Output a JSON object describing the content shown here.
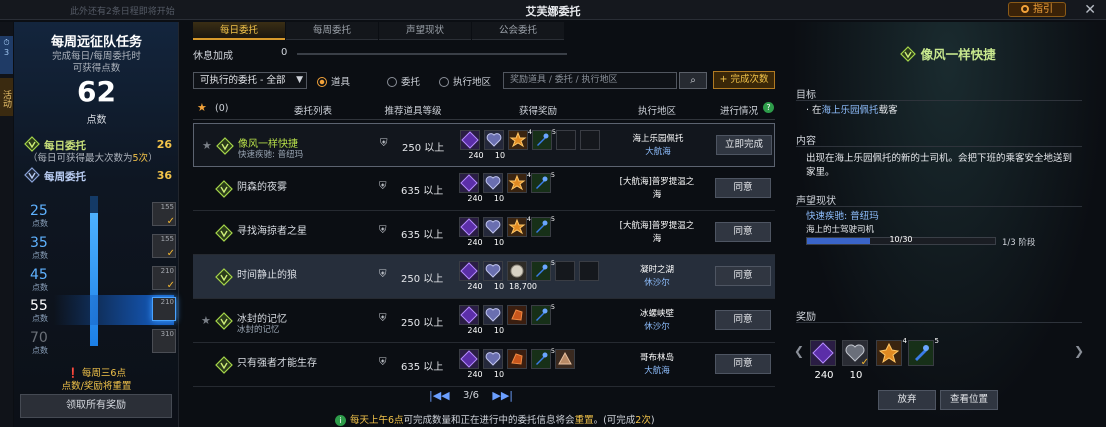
{
  "window": {
    "title": "艾芙娜委托",
    "notice": "此外还有2条日程即将开始",
    "guide": "指引"
  },
  "edge": {
    "count": "3",
    "label": "活动"
  },
  "left": {
    "title": "每周远征队任务",
    "subtitle": "完成每日/每周委托时",
    "subtitle2": "可获得点数",
    "points": "62",
    "points_unit": "点数",
    "daily_label": "每日委托",
    "daily_value": "26",
    "note_pre": "（每日可获得最大次数为",
    "note_num": "5次",
    "note_post": "）",
    "weekly_label": "每周委托",
    "weekly_value": "36",
    "progress_fraction": 0.886,
    "tiers": [
      {
        "num": "25",
        "unit": "点数",
        "count": "155"
      },
      {
        "num": "35",
        "unit": "点数",
        "count": "155"
      },
      {
        "num": "45",
        "unit": "点数",
        "count": "210"
      },
      {
        "num": "55",
        "unit": "点数",
        "count": "210"
      },
      {
        "num": "70",
        "unit": "点数",
        "count": "310"
      }
    ],
    "reset_line1": "每周三6点",
    "reset_line2": "点数/奖励将重置",
    "claim_all": "领取所有奖励"
  },
  "tabs": [
    "每日委托",
    "每周委托",
    "声望现状",
    "公会委托"
  ],
  "rest": {
    "label": "休息加成",
    "value": "0"
  },
  "filter": {
    "select": "可执行的委托 - 全部",
    "radio_items": "道具",
    "radio_quest": "委托",
    "radio_area": "执行地区",
    "search_placeholder": "奖励道具 / 委托 / 执行地区",
    "complete_btn": "+ 完成次数"
  },
  "table": {
    "fav_count": "(0)",
    "headers": [
      "委托列表",
      "推荐道具等级",
      "获得奖励",
      "执行地区",
      "进行情况"
    ],
    "rows": [
      {
        "name": "像风一样快捷",
        "sub": "快速疾驰: 普纽玛",
        "level": "250 以上",
        "q1": "240",
        "q2": "10",
        "t3": "4",
        "t4": "5",
        "loc1": "海上乐园佩托",
        "loc2": "大航海",
        "action": "立即完成"
      },
      {
        "name": "阴森的夜雾",
        "sub": "",
        "level": "635 以上",
        "q1": "240",
        "q2": "10",
        "t3": "4",
        "t4": "5",
        "loc1": "[大航海]普罗提温之海",
        "loc2": "",
        "action": "同意"
      },
      {
        "name": "寻找海掠者之星",
        "sub": "",
        "level": "635 以上",
        "q1": "240",
        "q2": "10",
        "t3": "4",
        "t4": "5",
        "loc1": "[大航海]普罗提温之海",
        "loc2": "",
        "action": "同意"
      },
      {
        "name": "时间静止的狼",
        "sub": "",
        "level": "250 以上",
        "q1": "240",
        "q2": "10",
        "q3": "18,700",
        "t4": "5",
        "loc1": "凝时之湖",
        "loc2": "休沙尔",
        "action": "同意"
      },
      {
        "name": "冰封的记忆",
        "sub": "冰封的记忆",
        "level": "250 以上",
        "q1": "240",
        "q2": "10",
        "t4": "5",
        "loc1": "冰螺峡壁",
        "loc2": "休沙尔",
        "action": "同意"
      },
      {
        "name": "只有强者才能生存",
        "sub": "",
        "level": "635 以上",
        "q1": "240",
        "q2": "10",
        "t4": "5",
        "loc1": "哥布林岛",
        "loc2": "大航海",
        "action": "同意"
      }
    ]
  },
  "pager": {
    "text": "3/6"
  },
  "footer": {
    "pre": "每天上午6点",
    "mid": "可完成数量和正在进行中的委托信息将会",
    "hl": "重置",
    "post": "。(可完成",
    "num": "2次",
    "end": ")"
  },
  "detail": {
    "title": "像风一样快捷",
    "goal_label": "目标",
    "goal_pre": "· 在",
    "goal_place": "海上乐园佩托",
    "goal_post": "载客",
    "content_label": "内容",
    "content": "出现在海上乐园佩托的新的士司机。会把下班的乘客安全地送到家里。",
    "rep_label": "声望现状",
    "rep_name": "快速疾驰: 普纽玛",
    "rep_rank": "海上的士驾驶司机",
    "rep_progress": "10/30",
    "rep_fraction": 0.333,
    "rep_stage": "1/3 阶段",
    "reward_label": "奖励",
    "r_q1": "240",
    "r_q2": "10",
    "r_t3": "4",
    "r_t4": "5",
    "btn_give_up": "放弃",
    "btn_view_location": "查看位置"
  }
}
